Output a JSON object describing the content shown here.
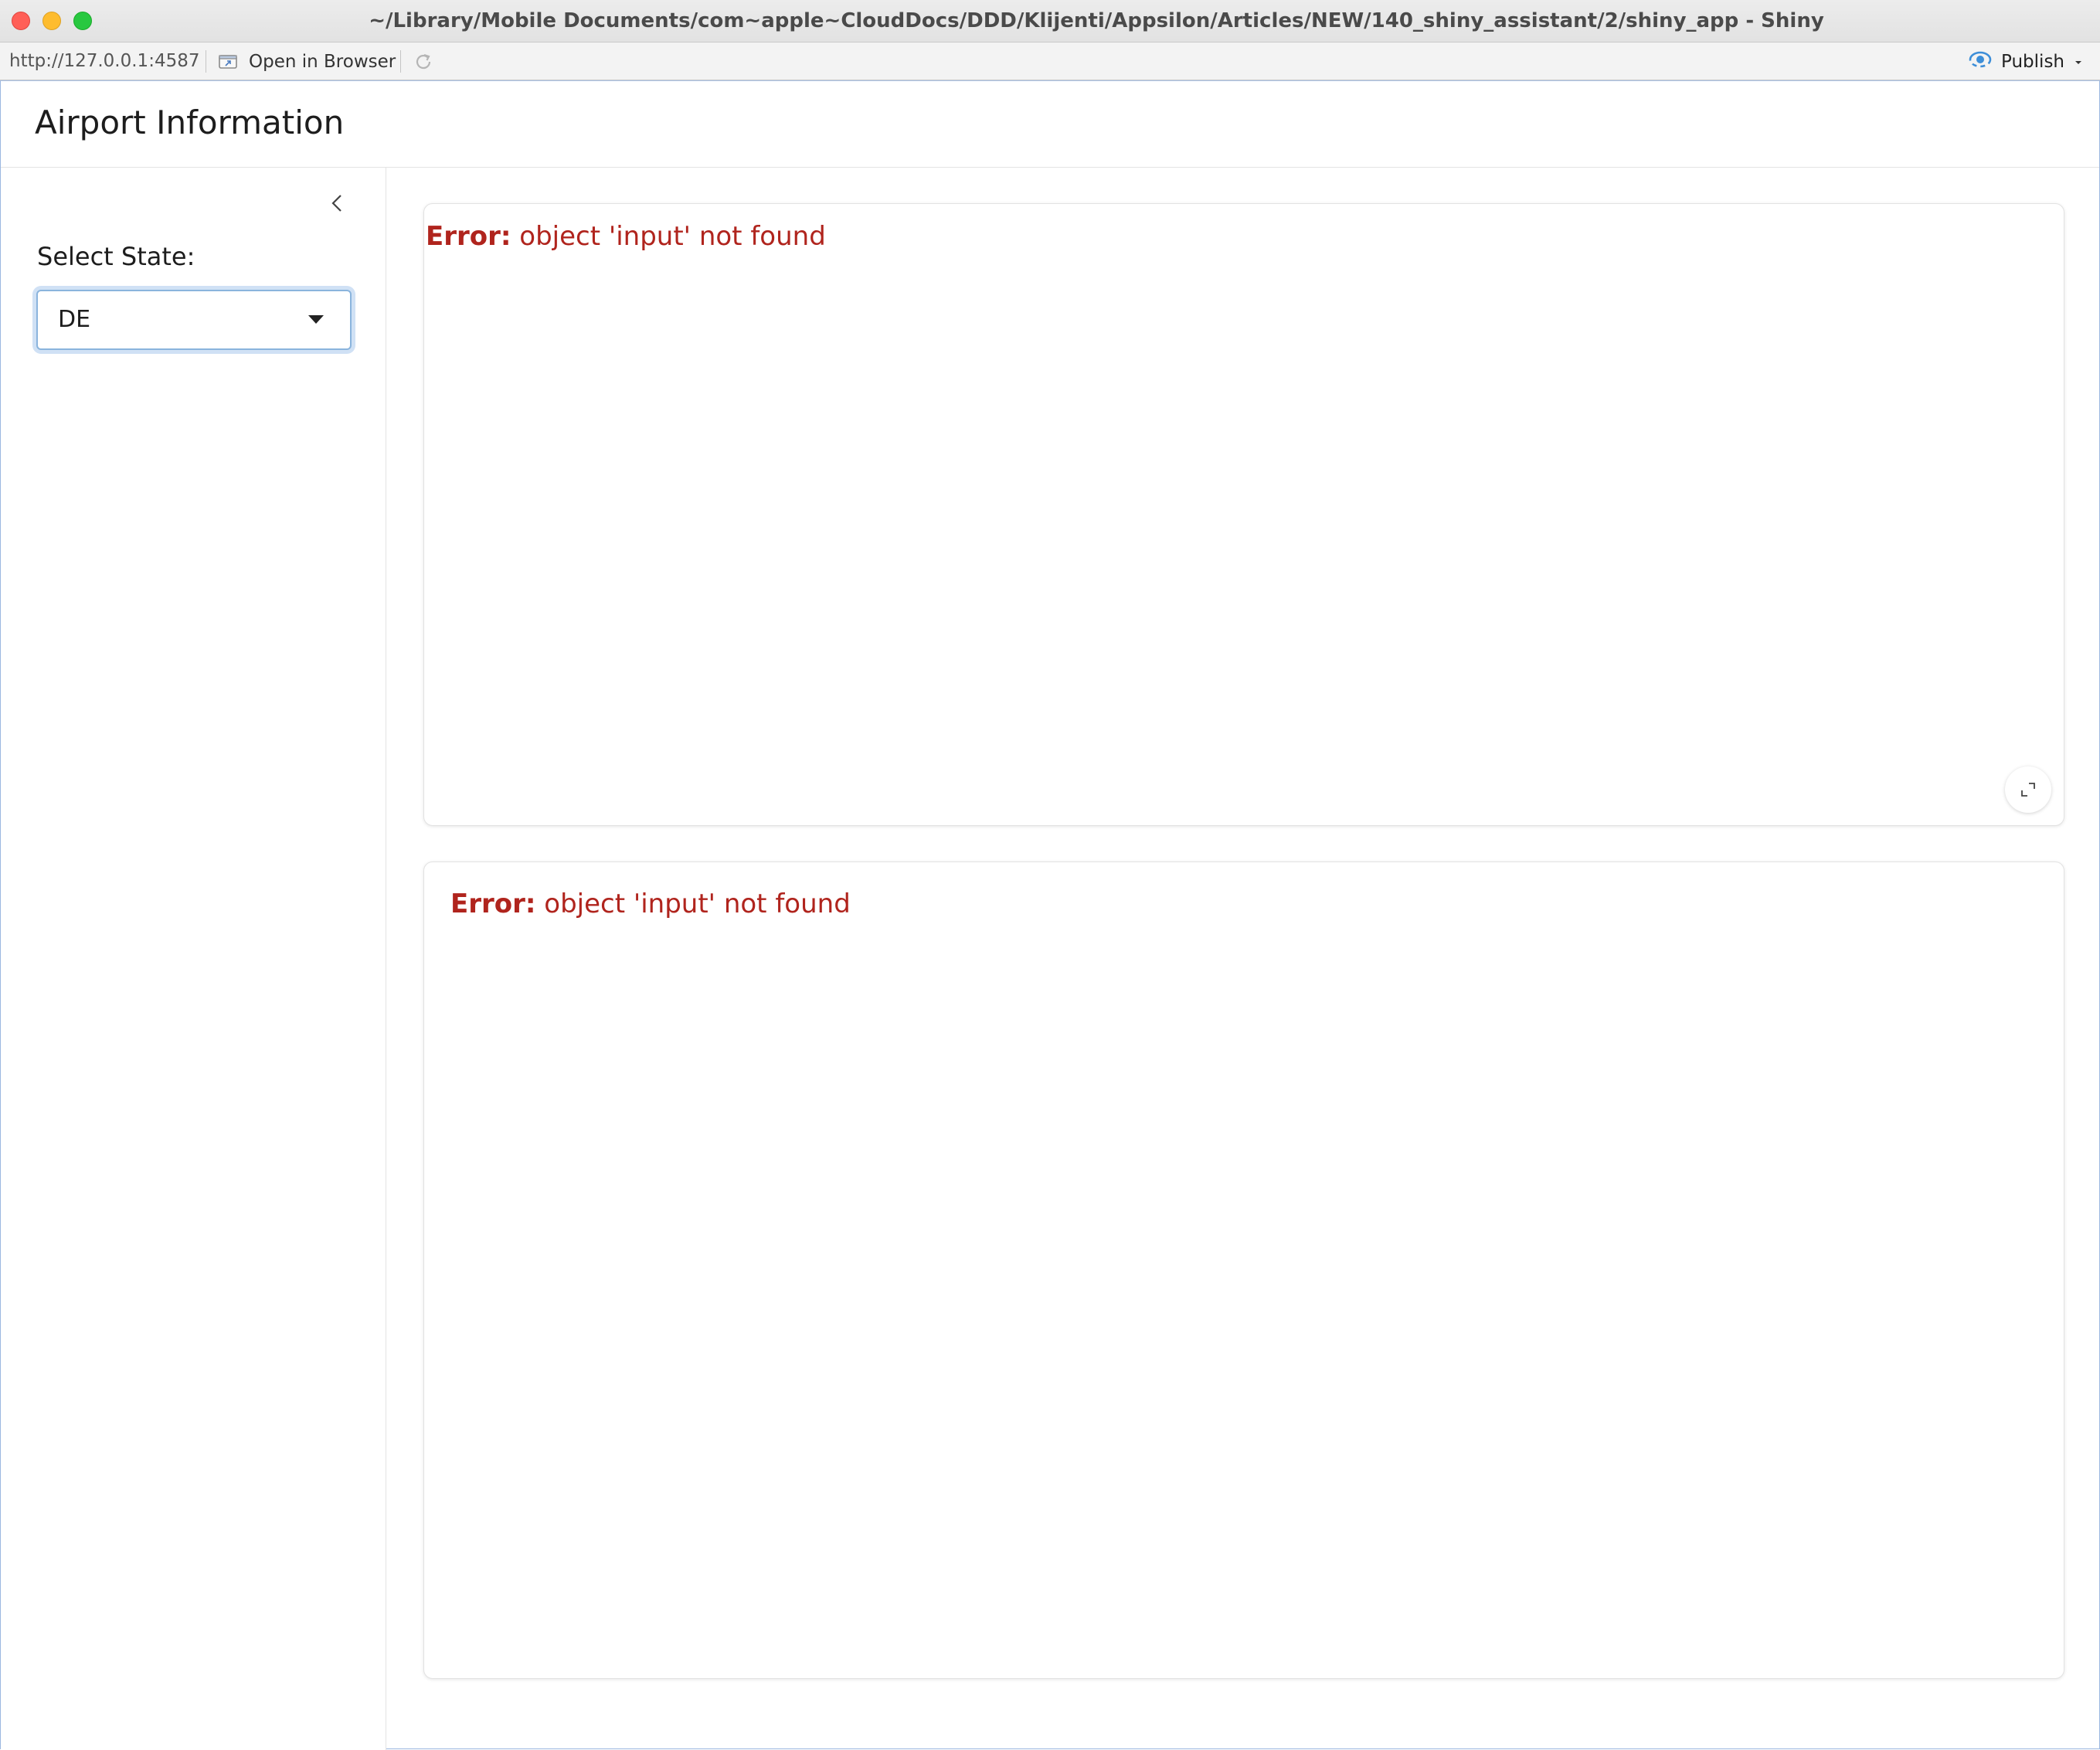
{
  "window": {
    "title": "~/Library/Mobile Documents/com~apple~CloudDocs/DDD/Klijenti/Appsilon/Articles/NEW/140_shiny_assistant/2/shiny_app - Shiny"
  },
  "toolbar": {
    "url": "http://127.0.0.1:4587",
    "open_in_browser_label": "Open in Browser",
    "publish_label": "Publish",
    "icons": [
      "open-in-browser-icon",
      "refresh-icon",
      "publish-icon",
      "chevron-down-icon"
    ]
  },
  "app": {
    "title": "Airport Information"
  },
  "sidebar": {
    "select_label": "Select State:",
    "select_value": "DE"
  },
  "cards": [
    {
      "error_label": "Error:",
      "error_message": " object 'input' not found"
    },
    {
      "error_label": "Error:",
      "error_message": " object 'input' not found"
    }
  ],
  "colors": {
    "error": "#b0241d",
    "focus_ring": "#8ab4dd",
    "publish_accent": "#3d8ed8"
  }
}
